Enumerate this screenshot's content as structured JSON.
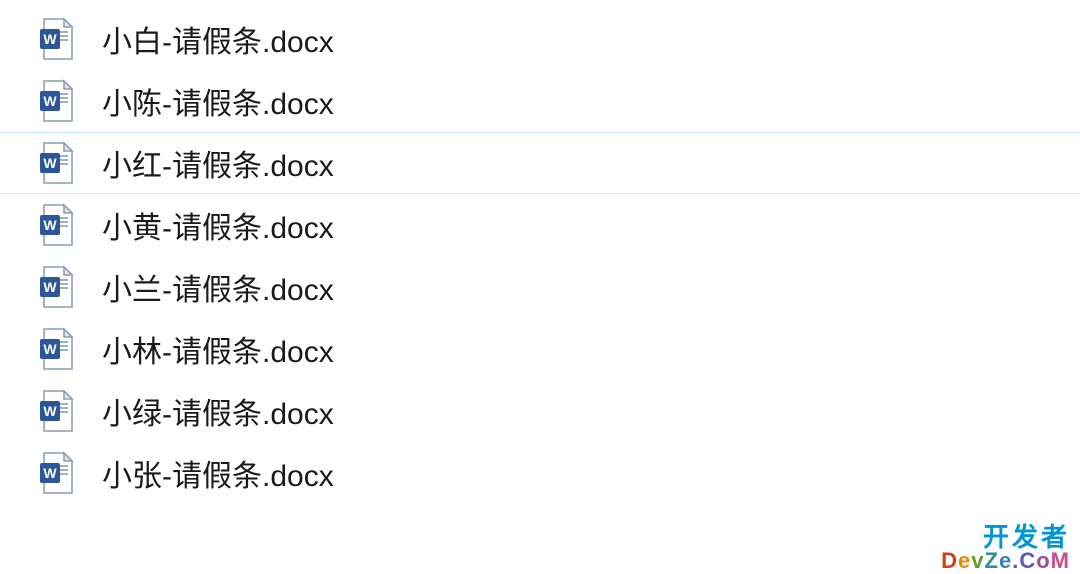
{
  "files": [
    {
      "name": "小白-请假条.docx",
      "selected": false
    },
    {
      "name": "小陈-请假条.docx",
      "selected": false
    },
    {
      "name": "小红-请假条.docx",
      "selected": true
    },
    {
      "name": "小黄-请假条.docx",
      "selected": false
    },
    {
      "name": "小兰-请假条.docx",
      "selected": false
    },
    {
      "name": "小林-请假条.docx",
      "selected": false
    },
    {
      "name": "小绿-请假条.docx",
      "selected": false
    },
    {
      "name": "小张-请假条.docx",
      "selected": false
    }
  ],
  "watermark": {
    "line1": "开发者",
    "line2": {
      "c1": "D",
      "c2": "e",
      "c3": "v",
      "c4": "Z",
      "c5": "e",
      "c6": ".C",
      "c7": "o",
      "c8": "M"
    }
  }
}
